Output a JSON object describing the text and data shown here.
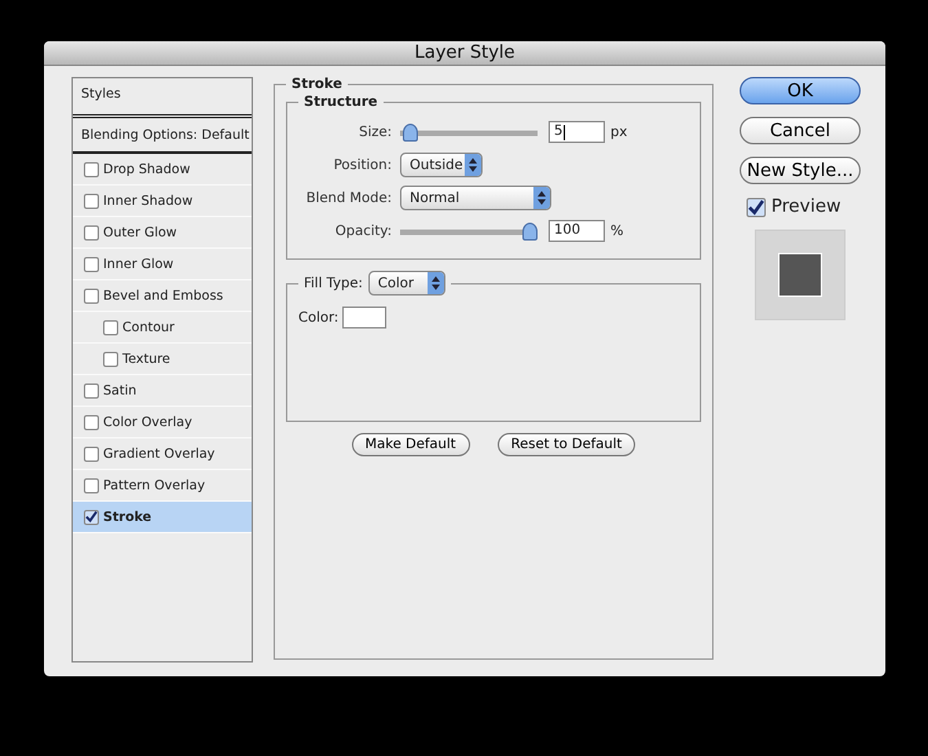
{
  "window": {
    "title": "Layer Style"
  },
  "styles": {
    "header": "Styles",
    "items": [
      {
        "label": "Blending Options: Default",
        "kind": "plain",
        "selected": false
      },
      {
        "label": "Drop Shadow",
        "kind": "check",
        "checked": false,
        "selected": false
      },
      {
        "label": "Inner Shadow",
        "kind": "check",
        "checked": false,
        "selected": false
      },
      {
        "label": "Outer Glow",
        "kind": "check",
        "checked": false,
        "selected": false
      },
      {
        "label": "Inner Glow",
        "kind": "check",
        "checked": false,
        "selected": false
      },
      {
        "label": "Bevel and Emboss",
        "kind": "check",
        "checked": false,
        "selected": false,
        "children": [
          {
            "label": "Contour",
            "kind": "check",
            "checked": false,
            "selected": false
          },
          {
            "label": "Texture",
            "kind": "check",
            "checked": false,
            "selected": false
          }
        ]
      },
      {
        "label": "Satin",
        "kind": "check",
        "checked": false,
        "selected": false
      },
      {
        "label": "Color Overlay",
        "kind": "check",
        "checked": false,
        "selected": false
      },
      {
        "label": "Gradient Overlay",
        "kind": "check",
        "checked": false,
        "selected": false
      },
      {
        "label": "Pattern Overlay",
        "kind": "check",
        "checked": false,
        "selected": false
      },
      {
        "label": "Stroke",
        "kind": "check",
        "checked": true,
        "selected": true
      }
    ]
  },
  "panel": {
    "title": "Stroke",
    "structure": {
      "title": "Structure",
      "size": {
        "label": "Size:",
        "level": 0.02,
        "value": "5",
        "unit": "px"
      },
      "position": {
        "label": "Position:",
        "value": "Outside"
      },
      "blend_mode": {
        "label": "Blend Mode:",
        "value": "Normal"
      },
      "opacity": {
        "label": "Opacity:",
        "level": 1,
        "value": "100",
        "unit": "%"
      }
    },
    "fill": {
      "label": "Fill Type:",
      "value": "Color",
      "color_label": "Color:",
      "color": "#ffffff"
    },
    "buttons": [
      "Make Default",
      "Reset to Default"
    ]
  },
  "actions": [
    {
      "label": "OK",
      "default": true
    },
    {
      "label": "Cancel",
      "default": false
    },
    {
      "label": "New Style...",
      "default": false
    }
  ],
  "preview": {
    "label": "Preview",
    "checked": true
  }
}
